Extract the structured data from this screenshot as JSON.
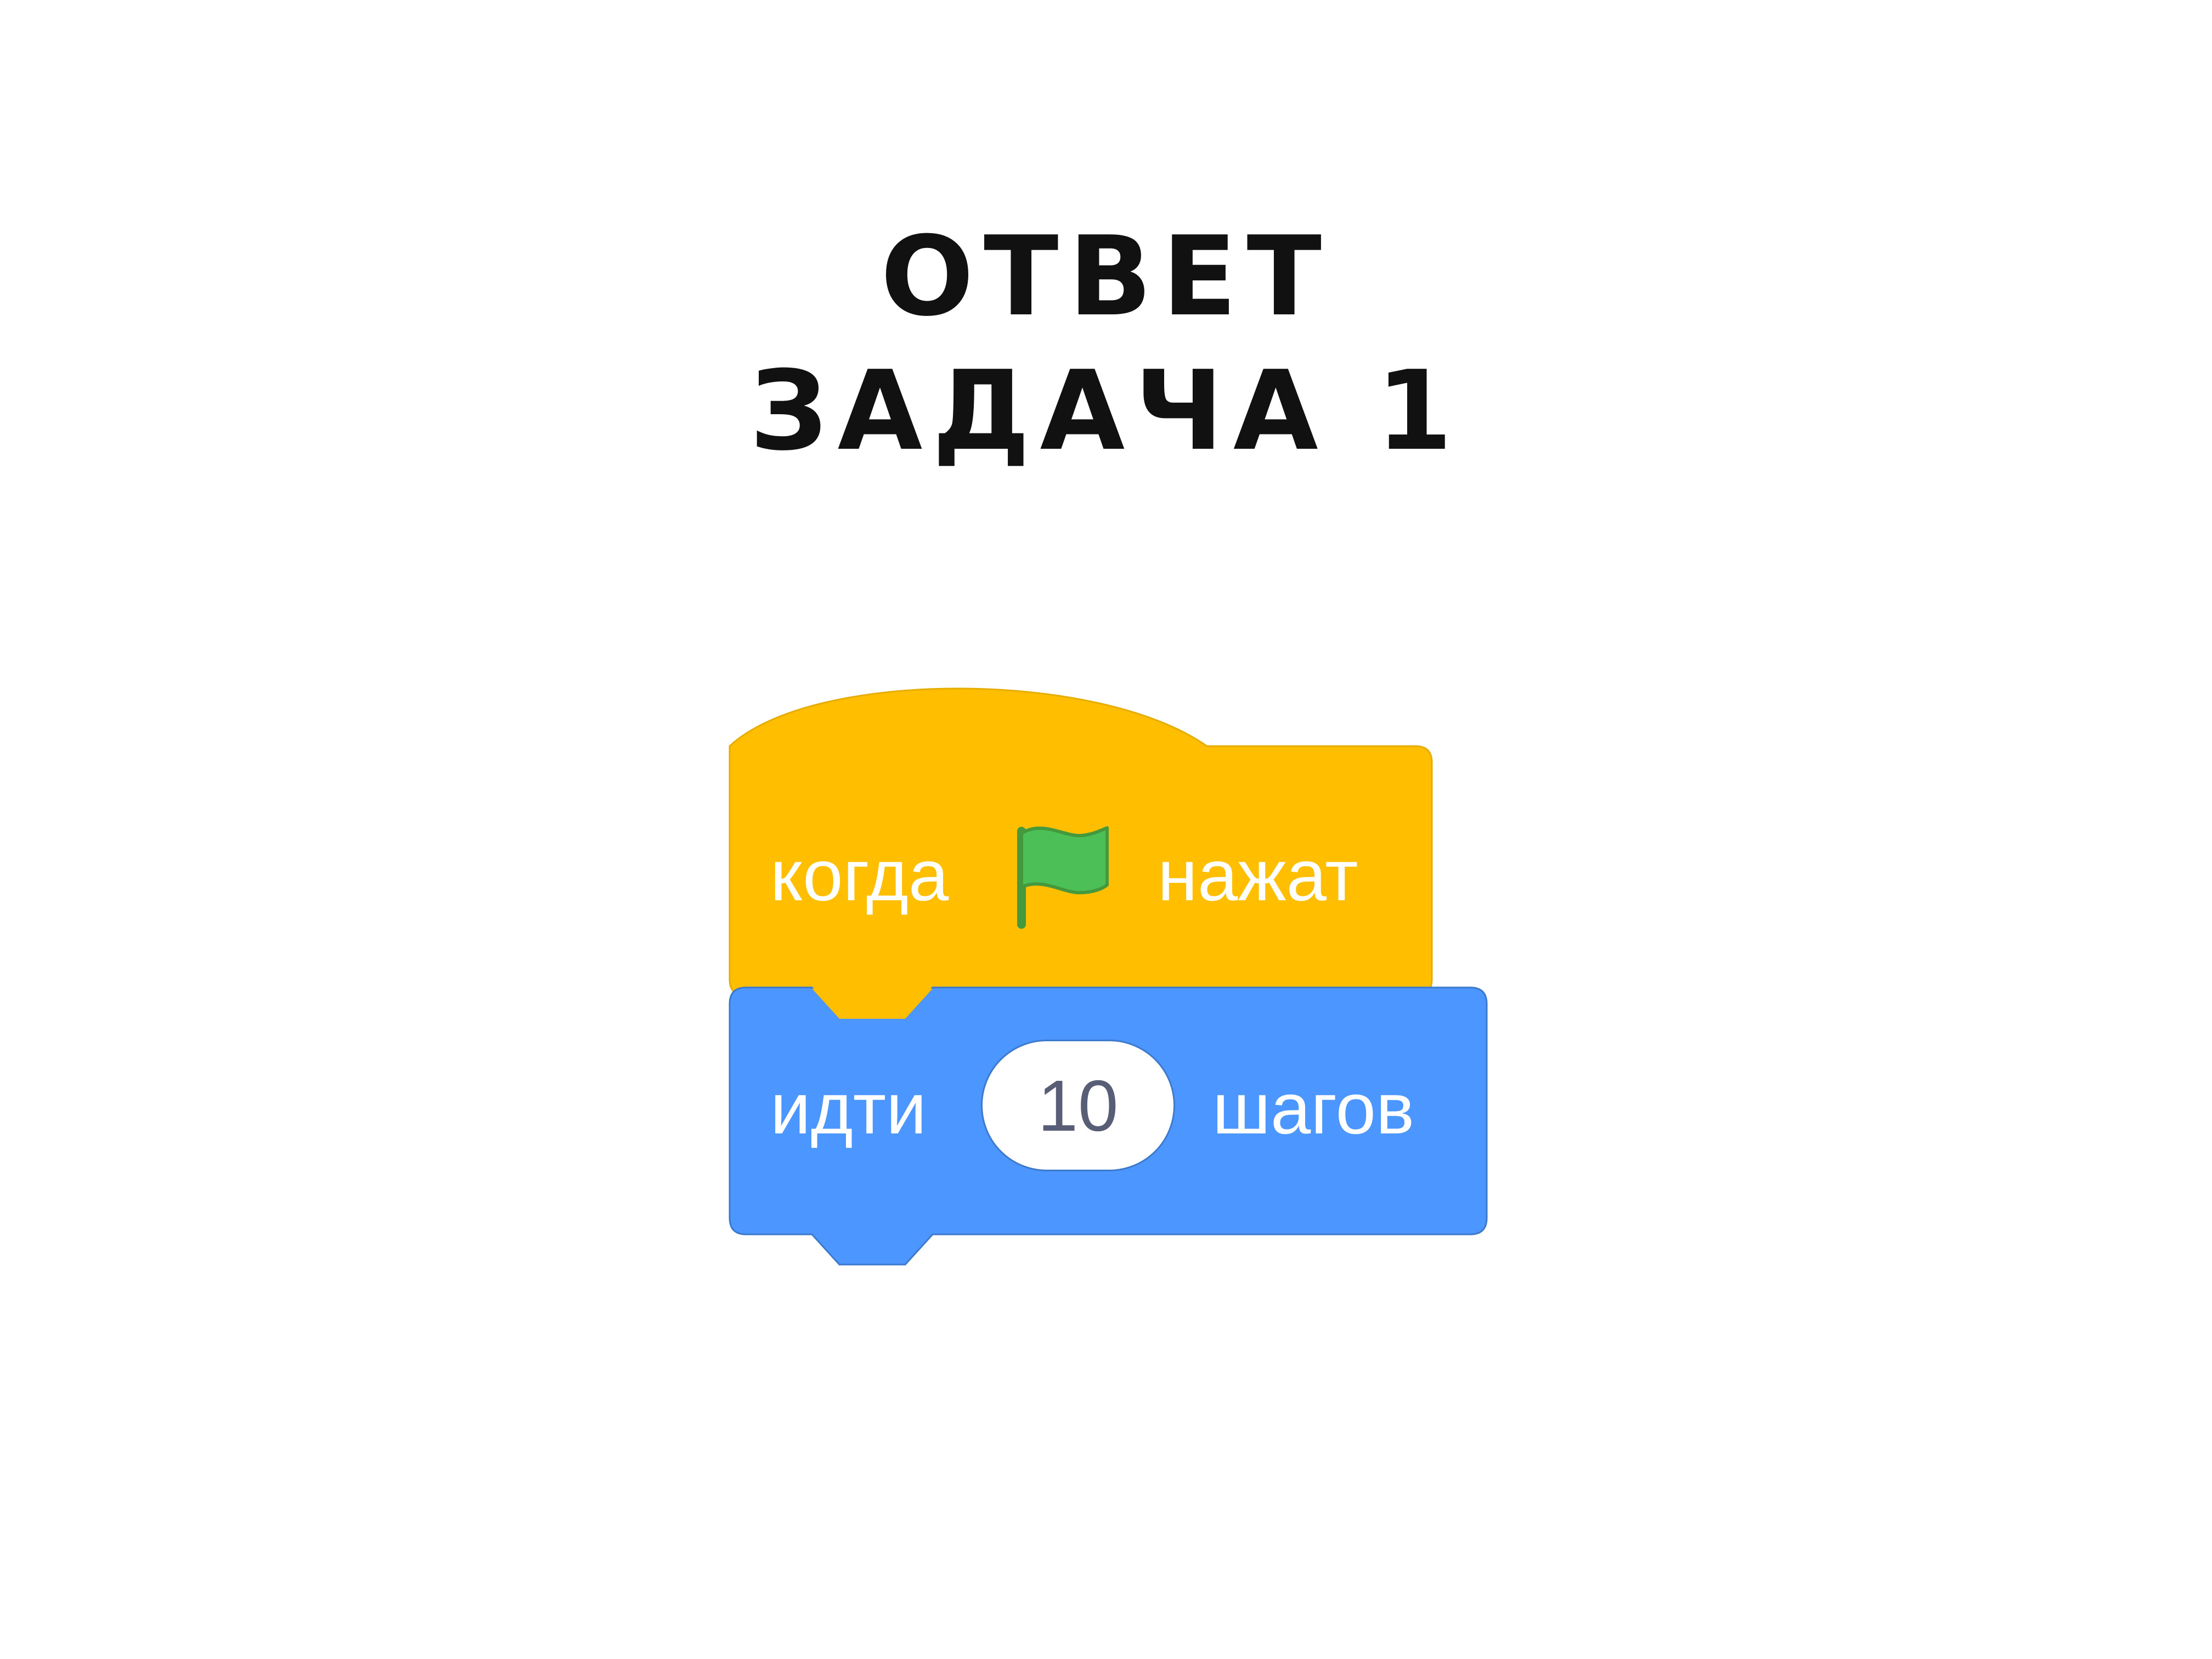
{
  "title": {
    "line1": "ОТВЕТ",
    "line2": "ЗАДАЧА 1"
  },
  "blocks": {
    "hat": {
      "category": "events",
      "color": "#ffbf00",
      "text_before": "когда",
      "icon": "green-flag-icon",
      "icon_color": "#4cbf56",
      "text_after": "нажат"
    },
    "motion": {
      "category": "motion",
      "color": "#4c97ff",
      "text_before": "идти",
      "input_value": "10",
      "text_after": "шагов"
    }
  }
}
